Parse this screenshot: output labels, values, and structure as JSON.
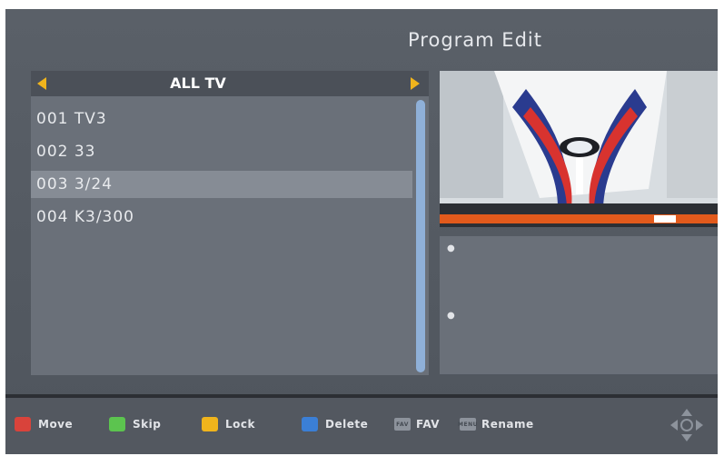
{
  "header": {
    "title": "Program Edit"
  },
  "group": {
    "name": "ALL TV"
  },
  "channels": [
    {
      "label": "001 TV3"
    },
    {
      "label": "002 33"
    },
    {
      "label": "003 3/24"
    },
    {
      "label": "004 K3/300"
    }
  ],
  "selected_channel": "003 3/24",
  "footer": {
    "move": {
      "label": "Move",
      "color": "#d9433b"
    },
    "skip": {
      "label": "Skip",
      "color": "#5cc44f"
    },
    "lock": {
      "label": "Lock",
      "color": "#f0b41c"
    },
    "delete": {
      "label": "Delete",
      "color": "#3b7fd6"
    },
    "fav": {
      "label": "FAV",
      "key": "FAV"
    },
    "rename": {
      "label": "Rename",
      "key": "MENU"
    }
  },
  "icons": [
    "arrow-left-icon",
    "arrow-right-icon",
    "nav-pad-icon"
  ],
  "colors": {
    "accent": "#f0b41c",
    "background": "#545a62",
    "selection": "#868c95"
  }
}
